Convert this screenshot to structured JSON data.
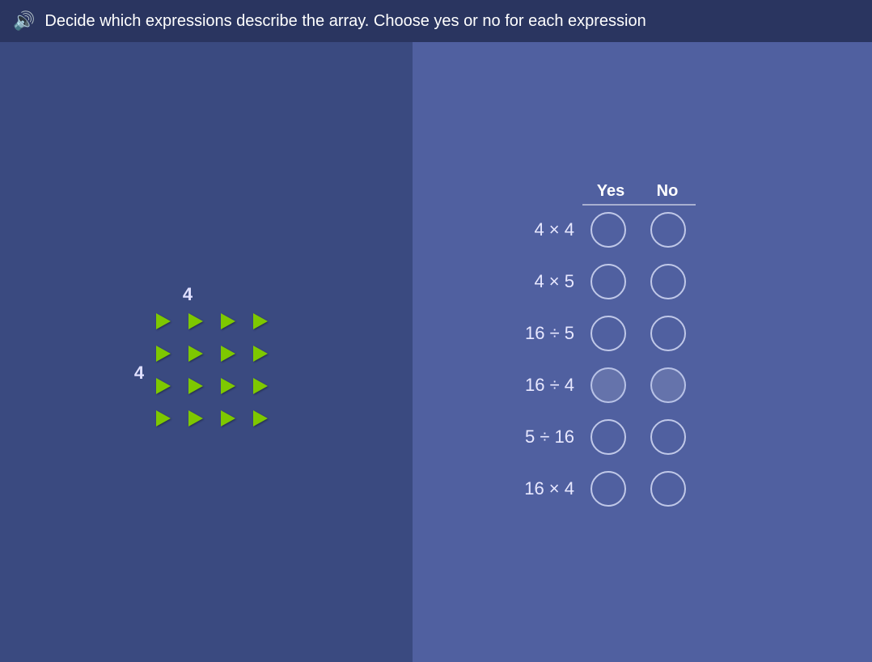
{
  "header": {
    "icon": "🔊",
    "text": "Decide which expressions describe the array. Choose yes or no for each expression"
  },
  "left_panel": {
    "label_top": "4",
    "label_left": "4"
  },
  "right_panel": {
    "columns": {
      "yes": "Yes",
      "no": "No"
    },
    "expressions": [
      {
        "id": "expr1",
        "label": "4 × 4"
      },
      {
        "id": "expr2",
        "label": "4 × 5"
      },
      {
        "id": "expr3",
        "label": "16 ÷ 5"
      },
      {
        "id": "expr4",
        "label": "16 ÷ 4"
      },
      {
        "id": "expr5",
        "label": "5 ÷ 16"
      },
      {
        "id": "expr6",
        "label": "16 × 4"
      }
    ]
  }
}
